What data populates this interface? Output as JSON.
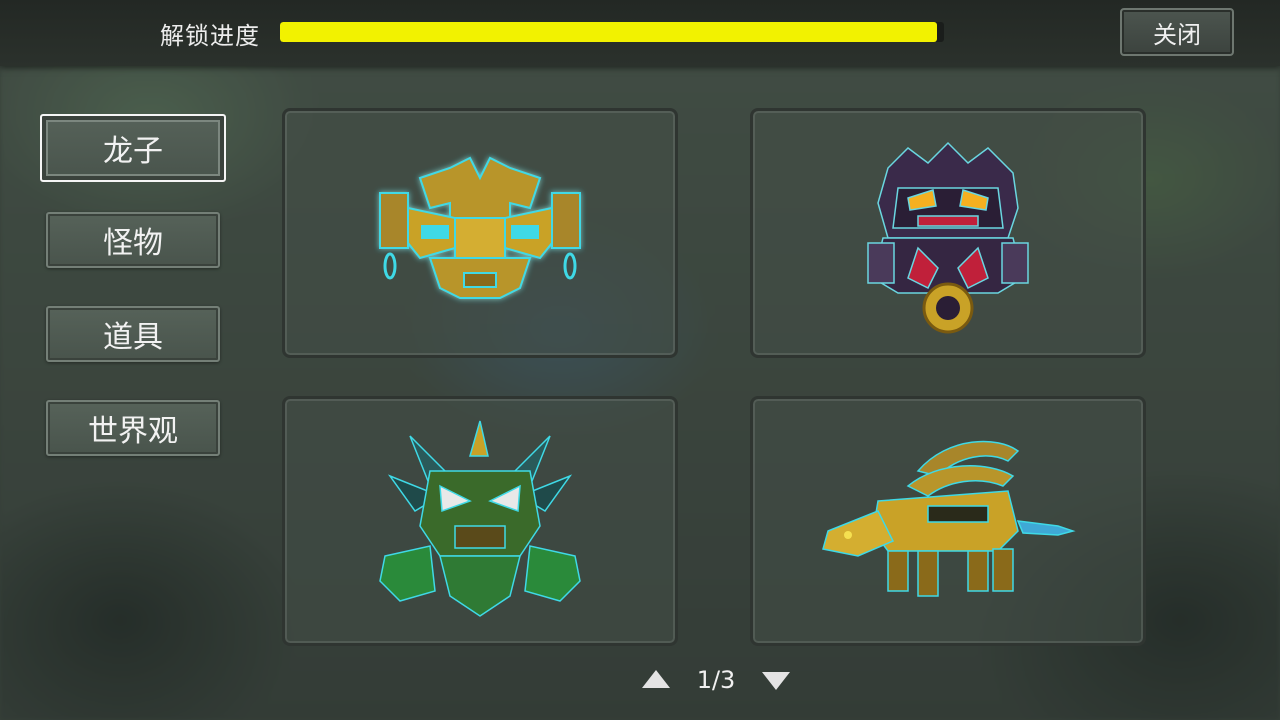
{
  "progress": {
    "label": "解锁进度",
    "value": 0.99
  },
  "close_label": "关闭",
  "categories": [
    {
      "label": "龙子",
      "active": true
    },
    {
      "label": "怪物",
      "active": false
    },
    {
      "label": "道具",
      "active": false
    },
    {
      "label": "世界观",
      "active": false
    }
  ],
  "cards": [
    {
      "icon": "golden-totem-mask-icon"
    },
    {
      "icon": "dark-demon-orb-icon"
    },
    {
      "icon": "green-spiked-beast-icon"
    },
    {
      "icon": "golden-mech-lion-icon"
    }
  ],
  "pager": {
    "text": "1/3"
  },
  "colors": {
    "progress": "#f2f200",
    "accent_cyan": "#3fd9e6",
    "gold": "#c9a227"
  }
}
